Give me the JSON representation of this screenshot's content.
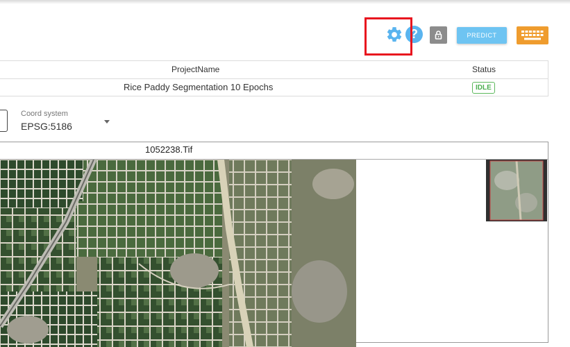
{
  "toolbar": {
    "predict_label": "PREDICT",
    "help_glyph": "?",
    "icons": [
      "gear-icon",
      "help-icon",
      "lock-icon",
      "keyboard-icon"
    ],
    "accent_color": "#5ab4ef",
    "highlight_color": "#e8141e"
  },
  "projects_table": {
    "columns": [
      "ProjectName",
      "Status"
    ],
    "rows": [
      {
        "name": "Rice Paddy Segmentation 10 Epochs",
        "status": "IDLE"
      }
    ],
    "status_color": "#4caf50"
  },
  "coord_system": {
    "label": "Coord system",
    "value": "EPSG:5186"
  },
  "viewer": {
    "file_name": "1052238.Tif"
  }
}
